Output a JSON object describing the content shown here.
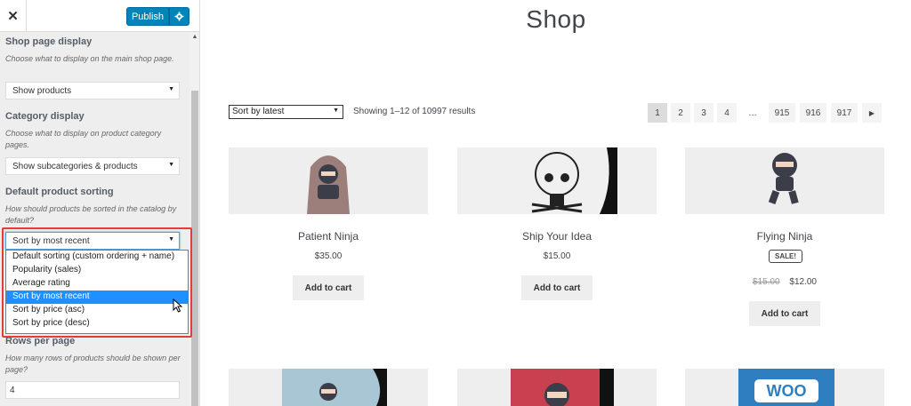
{
  "sidebar": {
    "publish_label": "Publish",
    "sections": {
      "shop_page_display": {
        "title": "Shop page display",
        "description": "Choose what to display on the main shop page.",
        "value": "Show products"
      },
      "category_display": {
        "title": "Category display",
        "description": "Choose what to display on product category pages.",
        "value": "Show subcategories & products"
      },
      "default_sorting": {
        "title": "Default product sorting",
        "description": "How should products be sorted in the catalog by default?",
        "value": "Sort by most recent",
        "options": [
          "Default sorting (custom ordering + name)",
          "Popularity (sales)",
          "Average rating",
          "Sort by most recent",
          "Sort by price (asc)",
          "Sort by price (desc)"
        ],
        "selected_index": 3
      },
      "rows_per_page": {
        "title": "Rows per page",
        "description": "How many rows of products should be shown per page?",
        "value": "4"
      }
    }
  },
  "shop": {
    "title": "Shop",
    "sort_value": "Sort by latest",
    "result_count": "Showing 1–12 of 10997 results",
    "pages": [
      "1",
      "2",
      "3",
      "4",
      "…",
      "915",
      "916",
      "917"
    ],
    "current_page": "1",
    "products": [
      {
        "name": "Patient Ninja",
        "price": "$35.00",
        "button": "Add to cart"
      },
      {
        "name": "Ship Your Idea",
        "price": "$15.00",
        "button": "Add to cart"
      },
      {
        "name": "Flying Ninja",
        "sale_badge": "SALE!",
        "old_price": "$15.00",
        "price": "$12.00",
        "button": "Add to cart"
      }
    ],
    "row2_images": [
      "WOO"
    ]
  },
  "colors": {
    "publish_blue": "#0085ba",
    "selected_option": "#1e90ff",
    "highlight_red": "#e63b3b"
  }
}
